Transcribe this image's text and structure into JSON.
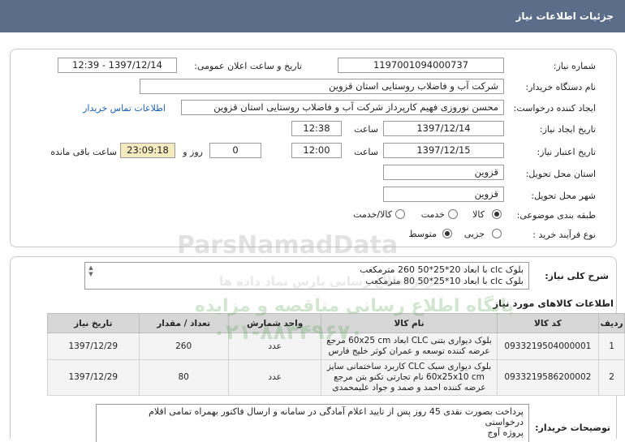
{
  "header": {
    "title": "جزئیات اطلاعات نیاز"
  },
  "form": {
    "need_number_label": "شماره نیاز:",
    "need_number": "1197001094000737",
    "announce_label": "تاریخ و ساعت اعلان عمومی:",
    "announce_value": "1397/12/14 - 12:39",
    "buyer_org_label": "نام دستگاه خریدار:",
    "buyer_org": "شرکت آب و فاضلاب روستایی استان قزوین",
    "requester_label": "ایجاد کننده درخواست:",
    "requester": "محسن نوروزی فهیم کارپرداز شرکت آب و فاضلاب روستایی استان قزوین",
    "contact_link": "اطلاعات تماس خریدار",
    "created_date_label": "تاریخ ایجاد نیاز:",
    "created_date": "1397/12/14",
    "time_label": "ساعت",
    "created_time": "12:38",
    "validity_label": "تاریخ اعتبار نیاز:",
    "validity_date": "1397/12/15",
    "validity_time": "12:00",
    "days_value": "0",
    "day_and_label": "روز و",
    "remaining_time": "23:09:18",
    "remaining_label": "ساعت باقی مانده",
    "province_label": "استان محل تحویل:",
    "province": "قزوین",
    "city_label": "شهر محل تحویل:",
    "city": "قزوین",
    "category_label": "طبقه بندی موضوعی:",
    "category_options": [
      "کالا",
      "خدمت",
      "کالا/خدمت"
    ],
    "process_label": "نوع فرآیند خرید :",
    "process_options": [
      "متوسط",
      "جزیی"
    ]
  },
  "summary": {
    "label": "شرح کلی نیاز:",
    "line1": "بلوک clc با ابعاد 20*25*50  260 مترمکعب",
    "line2": "بلوک clc  با ابعاد 10*25*50   80 مترمکعب"
  },
  "items_section": {
    "title": "اطلاعات کالاهای مورد نیاز",
    "headers": [
      "ردیف",
      "کد کالا",
      "نام کالا",
      "واحد شمارش",
      "تعداد / مقدار",
      "تاریخ نیاز"
    ],
    "rows": [
      {
        "index": "1",
        "code": "0933219504000001",
        "name": "بلوک دیواری بتنی CLC ابعاد 60x25 cm مرجع عرضه کننده توسعه و عمران کوثر خلیج فارس",
        "unit": "عدد",
        "qty": "260",
        "date": "1397/12/29"
      },
      {
        "index": "2",
        "code": "0933219586200002",
        "name": "بلوک دیواری سبک CLC کاربرد ساختمانی سایز 60x25x10 cm نام تجارتی تکنو بتن مرجع عرضه کننده احمد و صمد و جواد علیمحمدی",
        "unit": "عدد",
        "qty": "80",
        "date": "1397/12/29"
      }
    ]
  },
  "buyer_notes": {
    "label": "توضیحات خریدار:",
    "line1": "پرداخت بصورت نقدی 45 روز پس از تایید اعلام آمادگی در سامانه و ارسال فاکتور بهمراه تمامی اقلام",
    "line2": "درخواستی",
    "line3": "پروژه آوج"
  },
  "watermark": {
    "brand": "ParsNamadData",
    "tagline": "پایگاه اطلاع رسانی مناقصه و مزایده",
    "phone": "۰۲۱-۸۸۳۴۹۶۷۰",
    "slogan": "مرکز اطلاع رسانی پارس نماد داده ها"
  },
  "colors": {
    "header": "#5b6d89",
    "highlight": "#f3eac0",
    "link": "#1a5fb4",
    "table_header": "#d7d7d7"
  }
}
